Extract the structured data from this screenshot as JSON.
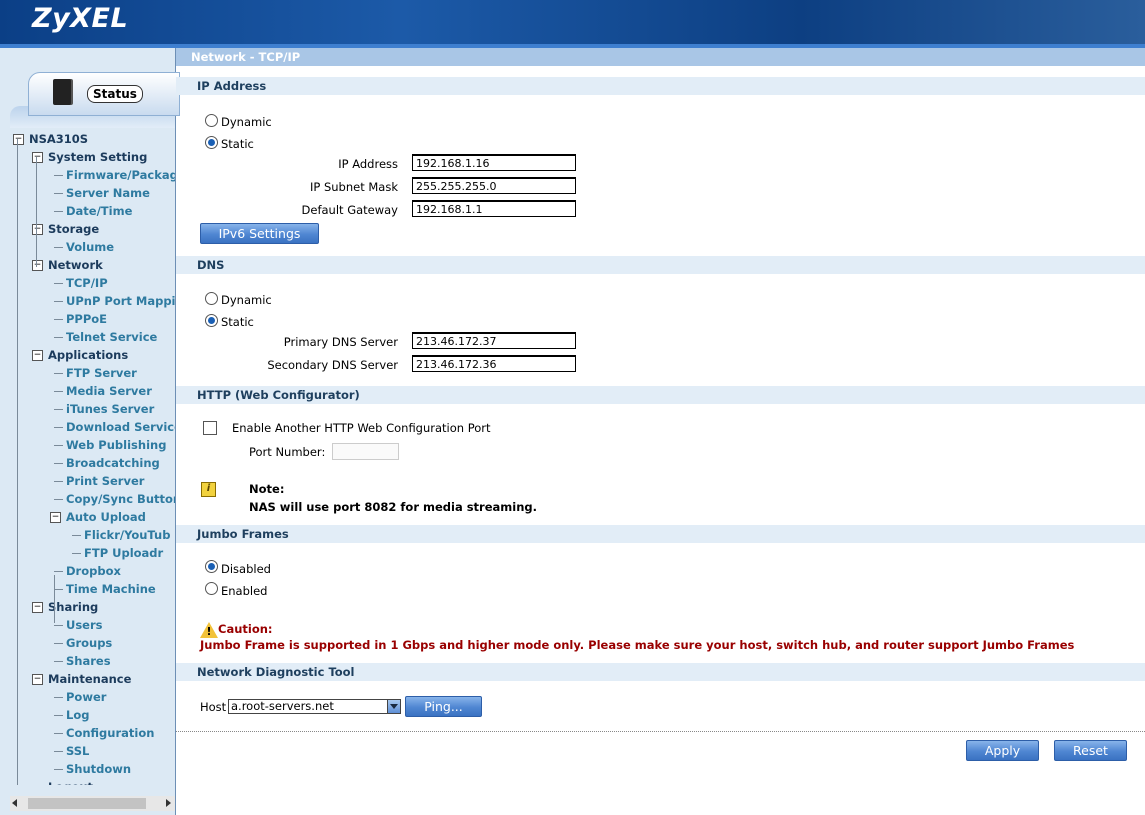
{
  "app": {
    "logo": "ZyXEL"
  },
  "sidebar": {
    "status_tab": "Status",
    "tree": [
      {
        "label": "NSA310S",
        "level": 0
      },
      {
        "label": "System Setting",
        "level": 1
      },
      {
        "label": "Firmware/Packag",
        "level": 2
      },
      {
        "label": "Server Name",
        "level": 2
      },
      {
        "label": "Date/Time",
        "level": 2
      },
      {
        "label": "Storage",
        "level": 1
      },
      {
        "label": "Volume",
        "level": 2
      },
      {
        "label": "Network",
        "level": 1
      },
      {
        "label": "TCP/IP",
        "level": 2
      },
      {
        "label": "UPnP Port Mappin",
        "level": 2
      },
      {
        "label": "PPPoE",
        "level": 2
      },
      {
        "label": "Telnet Service",
        "level": 2
      },
      {
        "label": "Applications",
        "level": 1
      },
      {
        "label": "FTP Server",
        "level": 2
      },
      {
        "label": "Media Server",
        "level": 2
      },
      {
        "label": "iTunes Server",
        "level": 2
      },
      {
        "label": "Download Service",
        "level": 2
      },
      {
        "label": "Web Publishing",
        "level": 2
      },
      {
        "label": "Broadcatching",
        "level": 2
      },
      {
        "label": "Print Server",
        "level": 2
      },
      {
        "label": "Copy/Sync Button",
        "level": 2
      },
      {
        "label": "Auto Upload",
        "level": 2
      },
      {
        "label": "Flickr/YouTub",
        "level": 3
      },
      {
        "label": "FTP Uploadr",
        "level": 3
      },
      {
        "label": "Dropbox",
        "level": 2
      },
      {
        "label": "Time Machine",
        "level": 2
      },
      {
        "label": "Sharing",
        "level": 1
      },
      {
        "label": "Users",
        "level": 2
      },
      {
        "label": "Groups",
        "level": 2
      },
      {
        "label": "Shares",
        "level": 2
      },
      {
        "label": "Maintenance",
        "level": 1
      },
      {
        "label": "Power",
        "level": 2
      },
      {
        "label": "Log",
        "level": 2
      },
      {
        "label": "Configuration",
        "level": 2
      },
      {
        "label": "SSL",
        "level": 2
      },
      {
        "label": "Shutdown",
        "level": 2
      },
      {
        "label": "Logout",
        "level": 1
      }
    ]
  },
  "main": {
    "page_title": "Network - TCP/IP",
    "ip": {
      "section": "IP Address",
      "dynamic_label": "Dynamic",
      "static_label": "Static",
      "mode": "Static",
      "ip_label": "IP Address",
      "ip_value": "192.168.1.16",
      "mask_label": "IP Subnet Mask",
      "mask_value": "255.255.255.0",
      "gateway_label": "Default Gateway",
      "gateway_value": "192.168.1.1",
      "ipv6_button": "IPv6 Settings"
    },
    "dns": {
      "section": "DNS",
      "dynamic_label": "Dynamic",
      "static_label": "Static",
      "mode": "Static",
      "primary_label": "Primary DNS Server",
      "primary_value": "213.46.172.37",
      "secondary_label": "Secondary DNS Server",
      "secondary_value": "213.46.172.36"
    },
    "http": {
      "section": "HTTP (Web Configurator)",
      "enable_label": "Enable Another HTTP Web Configuration Port",
      "enabled": false,
      "port_label": "Port Number:",
      "port_value": "",
      "note_title": "Note:",
      "note_text": "NAS will use port 8082 for media streaming."
    },
    "jumbo": {
      "section": "Jumbo Frames",
      "disabled_label": "Disabled",
      "enabled_label": "Enabled",
      "mode": "Disabled",
      "caution_title": "Caution:",
      "caution_text": "Jumbo Frame is supported in 1 Gbps and higher mode only. Please make sure your host, switch hub, and router support Jumbo Frames"
    },
    "diag": {
      "section": "Network Diagnostic Tool",
      "host_label": "Host",
      "host_value": "a.root-servers.net",
      "ping_button": "Ping..."
    },
    "actions": {
      "apply": "Apply",
      "reset": "Reset"
    }
  },
  "colors": {
    "header_blue": "#0b3f86",
    "section_bg": "#e2edf7",
    "title_bar": "#a9c6e6",
    "sidebar_bg": "#dce9f4",
    "link_text": "#2e7aa0",
    "caution_text": "#990000",
    "button_blue": "#4f86d2"
  }
}
